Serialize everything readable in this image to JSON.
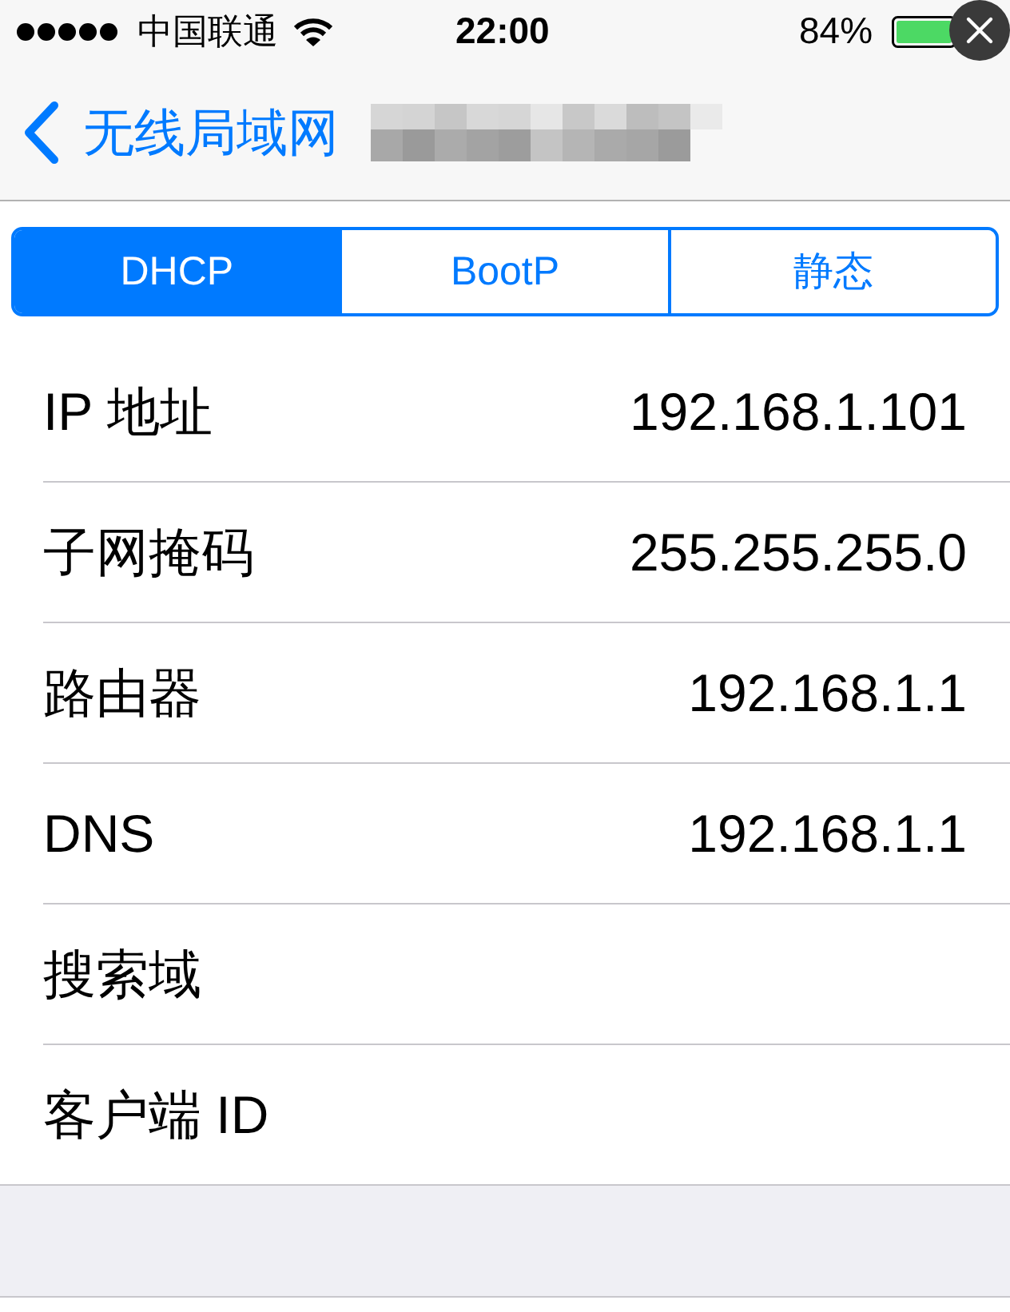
{
  "status_bar": {
    "carrier": "中国联通",
    "time": "22:00",
    "battery": "84%"
  },
  "nav_bar": {
    "back_label": "无线局域网"
  },
  "segments": [
    {
      "label": "DHCP",
      "selected": true
    },
    {
      "label": "BootP",
      "selected": false
    },
    {
      "label": "静态",
      "selected": false
    }
  ],
  "rows": [
    {
      "label": "IP 地址",
      "value": "192.168.1.101"
    },
    {
      "label": "子网掩码",
      "value": "255.255.255.0"
    },
    {
      "label": "路由器",
      "value": "192.168.1.1"
    },
    {
      "label": "DNS",
      "value": "192.168.1.1"
    },
    {
      "label": "搜索域"
    },
    {
      "label": "客户端 ID"
    }
  ]
}
